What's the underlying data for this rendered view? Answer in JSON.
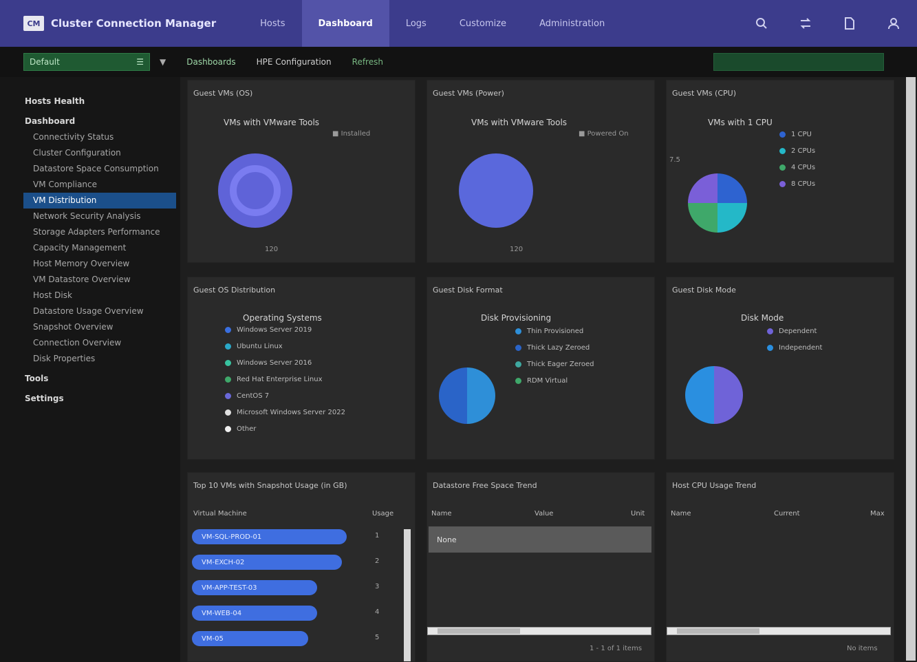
{
  "app": {
    "logo": "CM",
    "title": "Cluster Connection Manager"
  },
  "nav": {
    "tabs": [
      "Hosts",
      "Dashboard",
      "Logs",
      "Customize",
      "Administration"
    ],
    "active": 1
  },
  "top_icons": [
    "search-icon",
    "transfer-icon",
    "document-icon",
    "user-icon"
  ],
  "toolbar": {
    "context_value": "Default",
    "link_1": "Dashboards",
    "link_2": "HPE Configuration",
    "link_3": "Refresh"
  },
  "sidebar": {
    "items": [
      {
        "label": "Hosts Health",
        "kind": "section"
      },
      {
        "label": "Dashboard",
        "kind": "section"
      },
      {
        "label": "Connectivity Status",
        "kind": "sub"
      },
      {
        "label": "Cluster Configuration",
        "kind": "sub"
      },
      {
        "label": "Datastore Space Consumption",
        "kind": "sub"
      },
      {
        "label": "VM Compliance",
        "kind": "sub"
      },
      {
        "label": "VM Distribution",
        "kind": "active"
      },
      {
        "label": "Network Security Analysis",
        "kind": "sub"
      },
      {
        "label": "Storage Adapters Performance",
        "kind": "sub"
      },
      {
        "label": "Capacity Management",
        "kind": "sub"
      },
      {
        "label": "Host Memory Overview",
        "kind": "sub"
      },
      {
        "label": "VM Datastore Overview",
        "kind": "sub"
      },
      {
        "label": "Host Disk",
        "kind": "sub"
      },
      {
        "label": "Datastore Usage Overview",
        "kind": "sub"
      },
      {
        "label": "Snapshot Overview",
        "kind": "sub"
      },
      {
        "label": "Connection Overview",
        "kind": "sub"
      },
      {
        "label": "Disk Properties",
        "kind": "sub"
      },
      {
        "label": "Tools",
        "kind": "section"
      },
      {
        "label": "Settings",
        "kind": "section"
      }
    ]
  },
  "panels": {
    "p1": {
      "title": "Guest VMs (OS)",
      "heading": "VMs with VMware Tools",
      "sub": "■ Installed",
      "footer": "120",
      "colors": [
        "#5f63d8",
        "#7a7cf0"
      ]
    },
    "p2": {
      "title": "Guest VMs (Power)",
      "heading": "VMs with VMware Tools",
      "sub": "■ Powered On",
      "footer": "120"
    },
    "p3": {
      "title": "Guest VMs (CPU)",
      "heading": "VMs with 1 CPU",
      "legend": [
        "1 CPU",
        "2 CPUs",
        "4 CPUs",
        "8 CPUs"
      ],
      "side_label": "7.5",
      "colors": [
        "#2e63d0",
        "#24b8c8",
        "#3fa86a",
        "#7a5fd8"
      ]
    },
    "p4": {
      "title": "Guest OS Distribution",
      "heading": "Operating Systems",
      "legend": [
        "Windows Server 2019",
        "Ubuntu Linux",
        "Windows Server 2016",
        "Red Hat Enterprise Linux",
        "CentOS 7",
        "Microsoft Windows Server 2022",
        "Other"
      ],
      "colors": [
        "#3a6fe0",
        "#2aa8c8",
        "#38c3a0",
        "#3fa86a",
        "#6a68d8",
        "#e0e0e0",
        "#f0f0f0"
      ]
    },
    "p5": {
      "title": "Guest Disk Format",
      "heading": "Disk Provisioning",
      "legend": [
        "Thin Provisioned",
        "Thick Lazy Zeroed",
        "Thick Eager Zeroed",
        "RDM Virtual"
      ],
      "colors": [
        "#2e8fd8",
        "#2a64c8",
        "#3fa8a0",
        "#3fa86a"
      ]
    },
    "p6": {
      "title": "Guest Disk Mode",
      "heading": "Disk Mode",
      "legend": [
        "Dependent",
        "Independent"
      ],
      "colors": [
        "#6f63d8",
        "#2a8fe0"
      ]
    },
    "t1": {
      "title": "Top 10 VMs with Snapshot Usage (in GB)",
      "col_a": "Virtual Machine",
      "col_b": "Usage",
      "rows": [
        {
          "label": "VM-SQL-PROD-01",
          "value": 88
        },
        {
          "label": "VM-EXCH-02",
          "value": 85
        },
        {
          "label": "VM-APP-TEST-03",
          "value": 71
        },
        {
          "label": "VM-WEB-04",
          "value": 71
        },
        {
          "label": "VM-05",
          "value": 66
        }
      ],
      "counts": [
        "1",
        "2",
        "3",
        "4",
        "5"
      ]
    },
    "t2": {
      "title": "Datastore Free Space Trend",
      "cols": [
        "Name",
        "Value",
        "Unit"
      ],
      "empty": "None",
      "pager": "1 - 1 of 1 items"
    },
    "t3": {
      "title": "Host CPU Usage Trend",
      "cols": [
        "Name",
        "Current",
        "Max"
      ],
      "pager": "No items"
    }
  }
}
